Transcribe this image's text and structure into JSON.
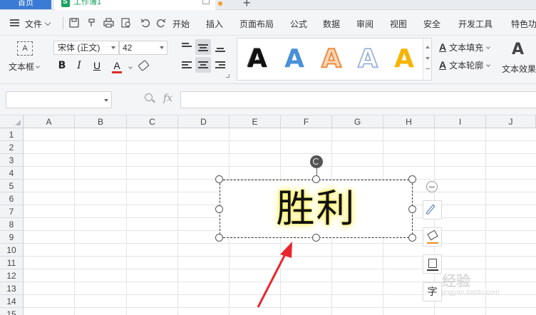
{
  "tabs": {
    "home": "首页",
    "document": "工作簿1"
  },
  "menu": {
    "file": "文件",
    "items": [
      "开始",
      "插入",
      "页面布局",
      "公式",
      "数据",
      "审阅",
      "视图",
      "安全",
      "开发工具",
      "特色功"
    ]
  },
  "ribbon": {
    "textbox_label": "文本框",
    "textbox_icon_text": "A",
    "font_name": "宋体 (正文)",
    "font_size": "42",
    "bold": "B",
    "italic": "I",
    "underline": "U",
    "font_color_glyph": "A",
    "style_glyph": "A",
    "text_fill": "文本填充",
    "text_outline": "文本轮廓",
    "text_effect": "文本效果",
    "effect_icon": "A"
  },
  "formula_bar": {
    "name_box": "",
    "fx": "fx",
    "formula": ""
  },
  "columns": [
    "A",
    "B",
    "C",
    "D",
    "E",
    "F",
    "G",
    "H",
    "I",
    "J"
  ],
  "rows": [
    "1",
    "2",
    "3",
    "4",
    "5",
    "6",
    "7",
    "8",
    "9",
    "10",
    "11",
    "12",
    "13",
    "14",
    "15"
  ],
  "textbox": {
    "content": "胜利"
  },
  "side_toolbar": {
    "text_char": "字"
  },
  "colors": {
    "accent": "#3a7bd5",
    "sheet_green": "#1aa260",
    "glow": "#fff16a",
    "arrow": "#e8252b",
    "style_black": "#111111",
    "style_blue": "#4a90d9",
    "style_orange": "#ef8b3c",
    "style_outline": "#8aa8d8",
    "style_gold": "#f5b400"
  },
  "watermark": {
    "title": "经验",
    "sub": "jingyan.baidu.com"
  }
}
